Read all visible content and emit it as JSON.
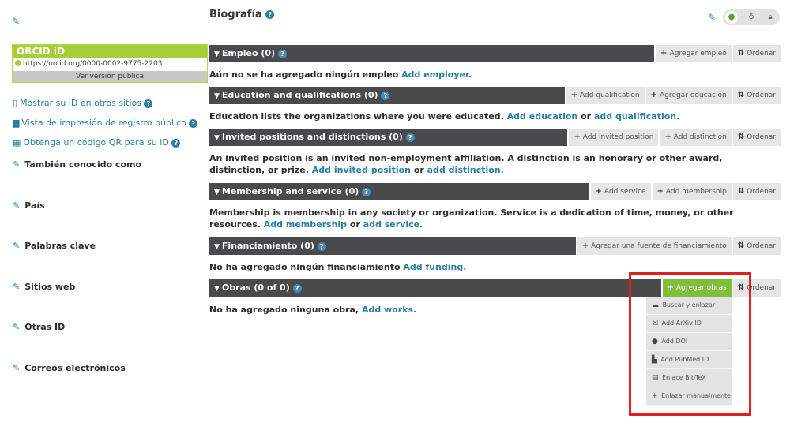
{
  "sidebar": {
    "orcid_title": "ORCID iD",
    "orcid_url": "https://orcid.org/0000-0002-9775-2203",
    "public_view": "Ver versión pública",
    "links": [
      {
        "icon": "mobile-icon",
        "label": "Mostrar su iD en otros sitios"
      },
      {
        "icon": "print-icon",
        "label": "Vista de impresión de registro público"
      },
      {
        "icon": "qr-icon",
        "label": "Obtenga un código QR para su iD"
      }
    ],
    "items": [
      "También conocido como",
      "País",
      "Palabras clave",
      "Sitios web",
      "Otras ID",
      "Correos electrónicos"
    ]
  },
  "header": {
    "title": "Biografía"
  },
  "sections": {
    "employment": {
      "title": "Empleo (0)",
      "buttons": [
        "Agregar empleo",
        "Ordenar"
      ],
      "desc": "Aún no se ha agregado ningún empleo",
      "link": "Add employer."
    },
    "education": {
      "title": "Education and qualifications (0)",
      "buttons": [
        "Add qualification",
        "Agregar educación",
        "Ordenar"
      ],
      "desc": "Education lists the organizations where you were educated.",
      "link1": "Add education",
      "mid": "or",
      "link2": "add qualification."
    },
    "invited": {
      "title": "Invited positions and distinctions (0)",
      "buttons": [
        "Add invited position",
        "Add distinction",
        "Ordenar"
      ],
      "desc": "An invited position is an invited non-employment affiliation. A distinction is an honorary or other award, distinction, or prize.",
      "link1": "Add invited position",
      "mid": "or",
      "link2": "add distinction."
    },
    "membership": {
      "title": "Membership and service (0)",
      "buttons": [
        "Add service",
        "Add membership",
        "Ordenar"
      ],
      "desc": "Membership is membership in any society or organization. Service is a dedication of time, money, or other resources.",
      "link1": "Add membership",
      "mid": "or",
      "link2": "add service."
    },
    "funding": {
      "title": "Financiamiento (0)",
      "buttons": [
        "Agregar una fuente de financiamiento",
        "Ordenar"
      ],
      "desc": "No ha agregado ningún financiamiento",
      "link": "Add funding."
    },
    "works": {
      "title": "Obras (0 of 0)",
      "buttons": [
        "Agregar obras",
        "Ordenar"
      ],
      "desc": "No ha agregado ninguna obra,",
      "link": "Add works."
    }
  },
  "works_menu": [
    {
      "icon": "cloud-icon",
      "label": "Buscar y enlazar"
    },
    {
      "icon": "arxiv-icon",
      "label": "Add ArXiv ID"
    },
    {
      "icon": "doi-icon",
      "label": "Add DOI"
    },
    {
      "icon": "pubmed-icon",
      "label": "Add PubMed ID"
    },
    {
      "icon": "bibtex-icon",
      "label": "Enlace BibTeX"
    },
    {
      "icon": "plus-icon",
      "label": "Enlazar manualmente"
    }
  ],
  "colors": {
    "accent": "#2b7da6",
    "orcid_green": "#a6ce39",
    "bar_dark": "#494a4c",
    "add_works_green": "#7fbf3b",
    "highlight_red": "#e02020"
  }
}
